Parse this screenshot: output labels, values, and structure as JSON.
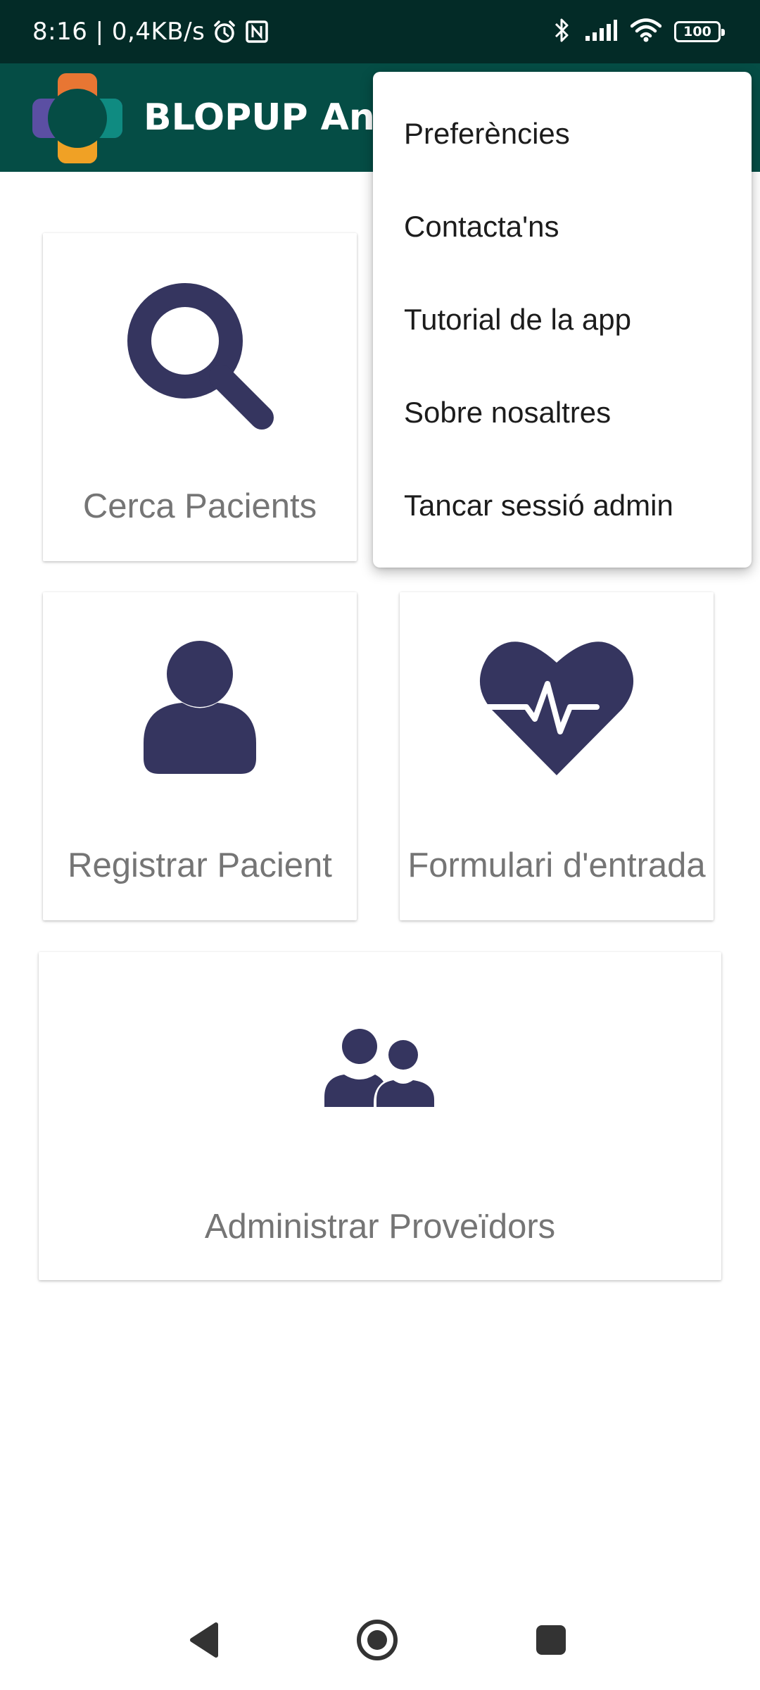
{
  "status_bar": {
    "time_speed": "8:16 | 0,4KB/s",
    "battery": "100"
  },
  "app_bar": {
    "title": "BLOPUP And"
  },
  "cards": {
    "search_patients": "Cerca Pacients",
    "register_patient": "Registrar Pacient",
    "intake_form": "Formulari d'entrada",
    "manage_providers": "Administrar Proveïdors"
  },
  "menu": {
    "items": [
      "Preferències",
      "Contacta'ns",
      "Tutorial de la app",
      "Sobre nosaltres",
      "Tancar sessió admin"
    ]
  },
  "colors": {
    "status_bar_bg": "#032b27",
    "app_bar_bg": "#054d45",
    "icon_color": "#35355f",
    "label_color": "#757575"
  }
}
